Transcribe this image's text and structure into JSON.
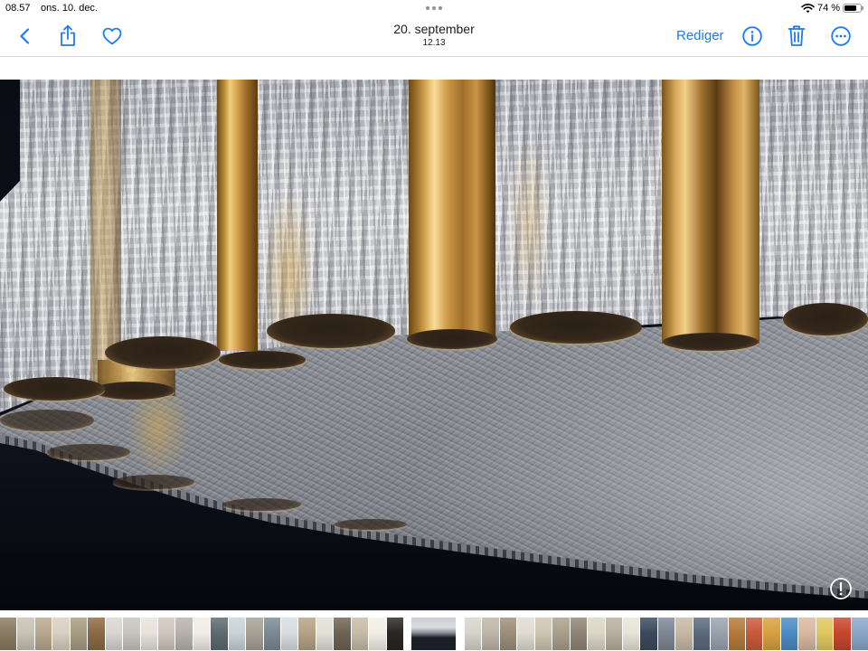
{
  "status_bar": {
    "time": "08.57",
    "date": "ons. 10. dec.",
    "battery_text": "74 %",
    "battery_level": 0.74,
    "icons": [
      "multitasking-dots-icon",
      "wifi-icon",
      "battery-icon"
    ]
  },
  "nav_bar": {
    "title": "20. september",
    "subtitle": "12.13",
    "edit_label": "Rediger",
    "accent_color": "#1b7cf4",
    "left_icons": [
      "chevron-left-icon",
      "share-icon",
      "heart-icon"
    ],
    "right_icons": [
      "info-icon",
      "trash-icon",
      "more-icon"
    ]
  },
  "photo": {
    "badge_icon": "exclamation-circle-icon"
  },
  "filmstrip": {
    "before": [
      "#8a7a62",
      "#c9c2b5",
      "#b9a88e",
      "#d8d0c0",
      "#a89c82",
      "#8c6a44",
      "#d9d6d2",
      "#c8c4c0",
      "#e8e2dc",
      "#cfc7bd",
      "#b7b2ac",
      "#f0ece6",
      "#5d6a6e",
      "#c9d3d8",
      "#a7a196",
      "#7b8a92",
      "#d7dde0",
      "#b3a286",
      "#e3e0d8",
      "#6e6454",
      "#c6bca8",
      "#f2efe6",
      "#2b2622"
    ],
    "current": "#1c1f27",
    "after": [
      "#d8d4cc",
      "#bfb6a6",
      "#9c8f7b",
      "#e0dcd4",
      "#cfc6b2",
      "#a99f8b",
      "#8f8576",
      "#dcd6c8",
      "#b8b0a0",
      "#e8e4da",
      "#3d4a5c",
      "#7d8794",
      "#c6b9a4",
      "#5b6a7c",
      "#98a2ae",
      "#b47a3c",
      "#c85a3c",
      "#d8a040",
      "#4b8bc4",
      "#d9b8a0",
      "#e0c860",
      "#c8462e",
      "#8aa8c8"
    ]
  }
}
